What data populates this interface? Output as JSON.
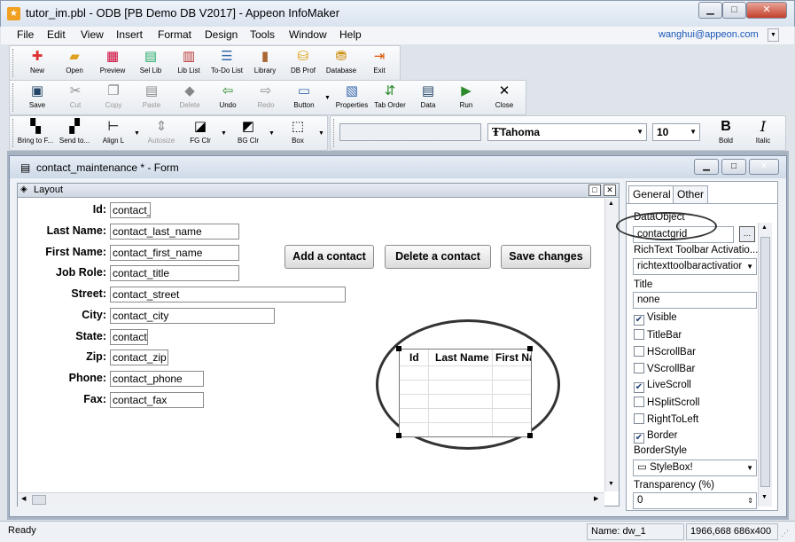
{
  "window": {
    "title": "tutor_im.pbl  -  ODB [PB Demo DB V2017]  - Appeon InfoMaker",
    "app_icon": "star-app-icon",
    "controls": [
      "minimize",
      "maximize",
      "close"
    ]
  },
  "menu": {
    "items": [
      "File",
      "Edit",
      "View",
      "Insert",
      "Format",
      "Design",
      "Tools",
      "Window",
      "Help"
    ],
    "user_email": "wanghui@appeon.com"
  },
  "toolbar1": {
    "buttons": [
      {
        "label": "New",
        "icon": "new-icon"
      },
      {
        "label": "Open",
        "icon": "open-folder-icon"
      },
      {
        "label": "Preview",
        "icon": "preview-icon"
      },
      {
        "label": "Sel Lib",
        "icon": "select-library-icon"
      },
      {
        "label": "Lib List",
        "icon": "library-list-icon"
      },
      {
        "label": "To-Do List",
        "icon": "todo-list-icon"
      },
      {
        "label": "Library",
        "icon": "library-icon"
      },
      {
        "label": "DB Prof",
        "icon": "db-profile-icon"
      },
      {
        "label": "Database",
        "icon": "database-icon"
      },
      {
        "label": "Exit",
        "icon": "exit-icon"
      }
    ]
  },
  "toolbar2": {
    "buttons": [
      {
        "label": "Save",
        "icon": "save-icon",
        "enabled": true
      },
      {
        "label": "Cut",
        "icon": "cut-icon",
        "enabled": false
      },
      {
        "label": "Copy",
        "icon": "copy-icon",
        "enabled": false
      },
      {
        "label": "Paste",
        "icon": "paste-icon",
        "enabled": false
      },
      {
        "label": "Delete",
        "icon": "delete-icon",
        "enabled": false
      },
      {
        "label": "Undo",
        "icon": "undo-icon",
        "enabled": true
      },
      {
        "label": "Redo",
        "icon": "redo-icon",
        "enabled": false
      },
      {
        "label": "Button",
        "icon": "button-control-icon",
        "enabled": true
      },
      {
        "label": "Properties",
        "icon": "properties-icon",
        "enabled": true
      },
      {
        "label": "Tab Order",
        "icon": "tab-order-icon",
        "enabled": true
      },
      {
        "label": "Data",
        "icon": "data-icon",
        "enabled": true
      },
      {
        "label": "Run",
        "icon": "run-icon",
        "enabled": true
      },
      {
        "label": "Close",
        "icon": "close-icon",
        "enabled": true
      }
    ]
  },
  "toolbar3": {
    "buttons": [
      {
        "label": "Bring to F...",
        "icon": "bring-to-front-icon"
      },
      {
        "label": "Send to...",
        "icon": "send-to-back-icon"
      },
      {
        "label": "Align L",
        "icon": "align-left-icon"
      },
      {
        "label": "Autosize",
        "icon": "autosize-icon"
      },
      {
        "label": "FG Clr",
        "icon": "foreground-color-icon"
      },
      {
        "label": "BG Clr",
        "icon": "background-color-icon"
      },
      {
        "label": "Box",
        "icon": "box-border-icon"
      }
    ],
    "font_name": "Tahoma",
    "font_size": "10",
    "bold_label": "Bold",
    "italic_label": "Italic"
  },
  "child_window": {
    "title": "contact_maintenance * - Form",
    "icon": "form-icon"
  },
  "layout": {
    "title": "Layout",
    "fields": [
      {
        "label": "Id:",
        "value": "contact_"
      },
      {
        "label": "Last Name:",
        "value": "contact_last_name"
      },
      {
        "label": "First Name:",
        "value": "contact_first_name"
      },
      {
        "label": "Job Role:",
        "value": "contact_title"
      },
      {
        "label": "Street:",
        "value": "contact_street"
      },
      {
        "label": "City:",
        "value": "contact_city"
      },
      {
        "label": "State:",
        "value": "contact"
      },
      {
        "label": "Zip:",
        "value": "contact_zip"
      },
      {
        "label": "Phone:",
        "value": "contact_phone"
      },
      {
        "label": "Fax:",
        "value": "contact_fax"
      }
    ],
    "buttons": [
      "Add a contact",
      "Delete a contact",
      "Save changes"
    ],
    "grid_columns": [
      "Id",
      "Last Name",
      "First Na"
    ]
  },
  "properties": {
    "tabs": [
      "General",
      "Other"
    ],
    "dataobject_label": "DataObject",
    "dataobject_value": "contactgrid",
    "richtext_label": "RichText Toolbar Activatio...",
    "richtext_value": "richtexttoolbaractivatior",
    "title_label": "Title",
    "title_value": "none",
    "checkboxes": [
      {
        "label": "Visible",
        "checked": true
      },
      {
        "label": "TitleBar",
        "checked": false
      },
      {
        "label": "HScrollBar",
        "checked": false
      },
      {
        "label": "VScrollBar",
        "checked": false
      },
      {
        "label": "LiveScroll",
        "checked": true
      },
      {
        "label": "HSplitScroll",
        "checked": false
      },
      {
        "label": "RightToLeft",
        "checked": false
      },
      {
        "label": "Border",
        "checked": true
      }
    ],
    "borderstyle_label": "BorderStyle",
    "borderstyle_value": "StyleBox!",
    "transparency_label": "Transparency (%)",
    "transparency_value": "0"
  },
  "status": {
    "text": "Ready",
    "name": "Name: dw_1",
    "coords": "1966,668 686x400"
  },
  "colors": {
    "accent": "#1a56b8",
    "titlebar": "#d9e3ef",
    "annotation": "#333333"
  }
}
